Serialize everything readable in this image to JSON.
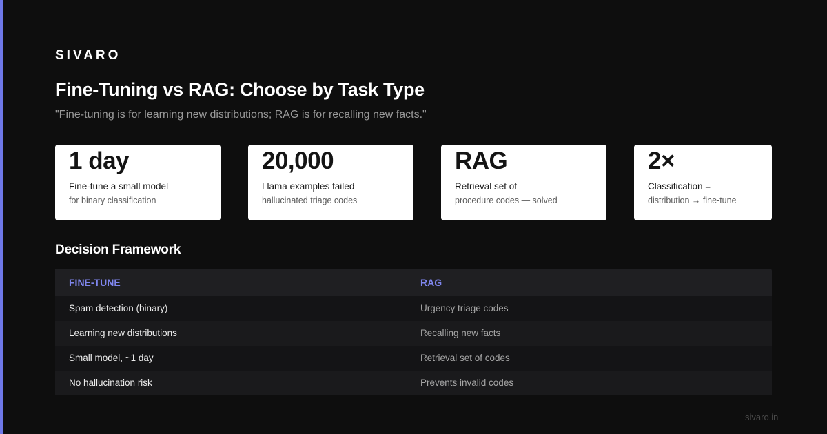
{
  "brand": "SIVARO",
  "title": "Fine-Tuning vs RAG: Choose by Task Type",
  "subtitle": "\"Fine-tuning is for learning new distributions; RAG is for recalling new facts.\"",
  "accent_color": "#6e78e8",
  "cards": [
    {
      "stat": "1 day",
      "label": "Fine-tune a small model",
      "sub": "for binary classification"
    },
    {
      "stat": "20,000",
      "label": "Llama examples failed",
      "sub": "hallucinated triage codes"
    },
    {
      "stat": "RAG",
      "label": "Retrieval set of",
      "sub": "procedure codes — solved"
    },
    {
      "stat": "2×",
      "label": "Classification =",
      "sub": "distribution → fine-tune"
    }
  ],
  "framework": {
    "title": "Decision Framework",
    "headers": [
      "FINE-TUNE",
      "RAG"
    ],
    "rows": [
      [
        "Spam detection (binary)",
        "Urgency triage codes"
      ],
      [
        "Learning new distributions",
        "Recalling new facts"
      ],
      [
        "Small model, ~1 day",
        "Retrieval set of codes"
      ],
      [
        "No hallucination risk",
        "Prevents invalid codes"
      ]
    ]
  },
  "footer": "sivaro.in"
}
